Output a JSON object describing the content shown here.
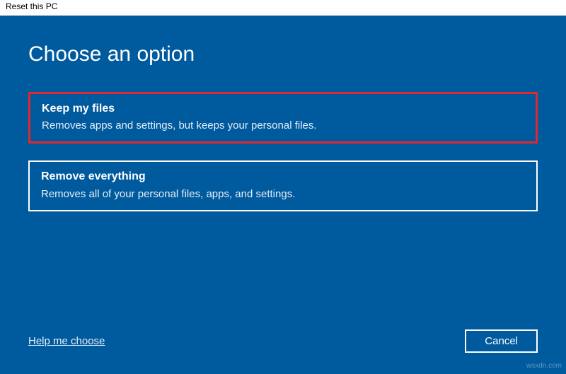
{
  "titlebar": {
    "title": "Reset this PC"
  },
  "dialog": {
    "heading": "Choose an option",
    "options": [
      {
        "title": "Keep my files",
        "description": "Removes apps and settings, but keeps your personal files.",
        "highlighted": true
      },
      {
        "title": "Remove everything",
        "description": "Removes all of your personal files, apps, and settings.",
        "highlighted": false
      }
    ],
    "help_link": "Help me choose",
    "cancel_label": "Cancel"
  },
  "watermark": "wsxdn.com"
}
